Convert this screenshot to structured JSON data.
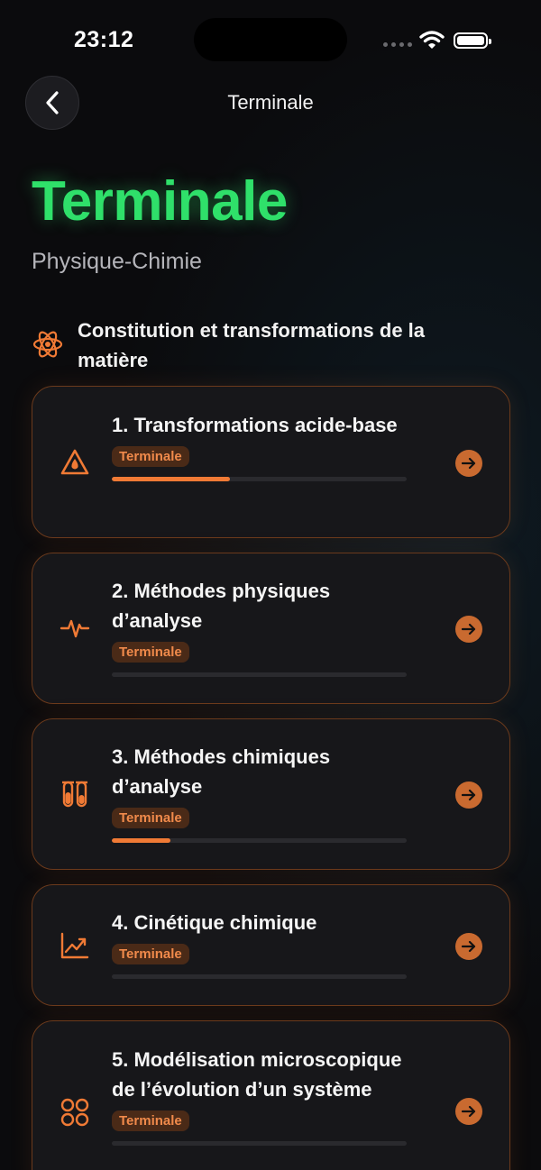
{
  "status": {
    "time": "23:12"
  },
  "nav": {
    "title": "Terminale"
  },
  "page": {
    "title": "Terminale",
    "subtitle": "Physique-Chimie"
  },
  "section": {
    "title": "Constitution et transformations de la matière",
    "icon": "atom-icon"
  },
  "colors": {
    "accent": "#f07a35",
    "title_green": "#2fe06a",
    "badge_bg": "#4a2a17",
    "card_border": "#6b3a1c"
  },
  "chapters": [
    {
      "title": "1. Transformations acide-base",
      "badge": "Terminale",
      "progress": 0.4,
      "icon": "drop-warning-icon"
    },
    {
      "title": "2. Méthodes physiques d’analyse",
      "badge": "Terminale",
      "progress": 0.0,
      "icon": "pulse-icon"
    },
    {
      "title": "3. Méthodes chimiques d’analyse",
      "badge": "Terminale",
      "progress": 0.2,
      "icon": "test-tubes-icon"
    },
    {
      "title": "4. Cinétique chimique",
      "badge": "Terminale",
      "progress": 0.0,
      "icon": "trend-chart-icon"
    },
    {
      "title": "5. Modélisation microscopique de l’évolution d’un système",
      "badge": "Terminale",
      "progress": 0.0,
      "icon": "four-circles-icon"
    }
  ]
}
